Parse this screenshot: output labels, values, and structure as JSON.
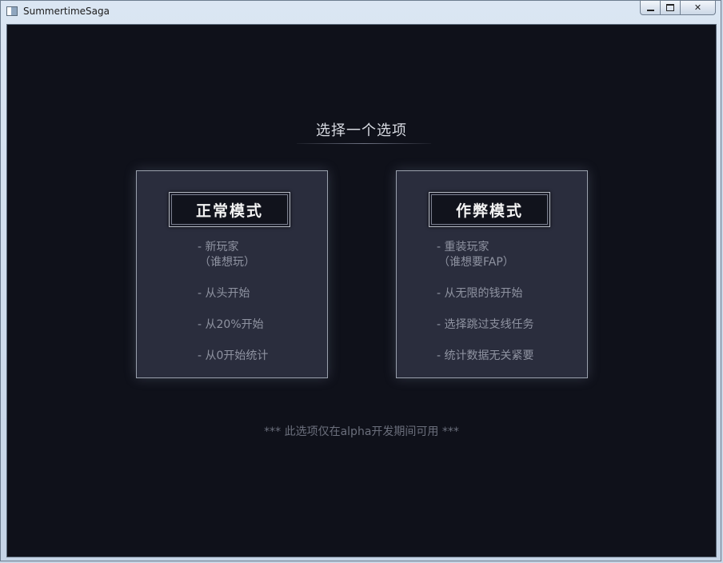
{
  "window": {
    "title": "SummertimeSaga",
    "app_icon": "window-app-icon",
    "minimize_icon": "minimize-icon",
    "maximize_icon": "maximize-icon",
    "close_glyph": "✕"
  },
  "screen": {
    "heading": "选择一个选项",
    "footnote": "***  此选项仅在alpha开发期间可用 ***"
  },
  "modes": {
    "normal": {
      "button_label": "正常模式",
      "features": [
        {
          "line": "- 新玩家",
          "sub": "（谁想玩）"
        },
        {
          "line": "- 从头开始"
        },
        {
          "line": "- 从20%开始"
        },
        {
          "line": "- 从0开始统计"
        }
      ]
    },
    "cheat": {
      "button_label": "作弊模式",
      "features": [
        {
          "line": "- 重装玩家",
          "sub": "（谁想要FAP）"
        },
        {
          "line": "- 从无限的钱开始"
        },
        {
          "line": "- 选择跳过支线任务"
        },
        {
          "line": "- 统计数据无关紧要"
        }
      ]
    }
  },
  "colors": {
    "background": "#0f111a",
    "card": "#2a2d3d",
    "card_border": "#9aa1ad",
    "feature_text": "#8f93a1",
    "heading_text": "#d8dbe2"
  }
}
